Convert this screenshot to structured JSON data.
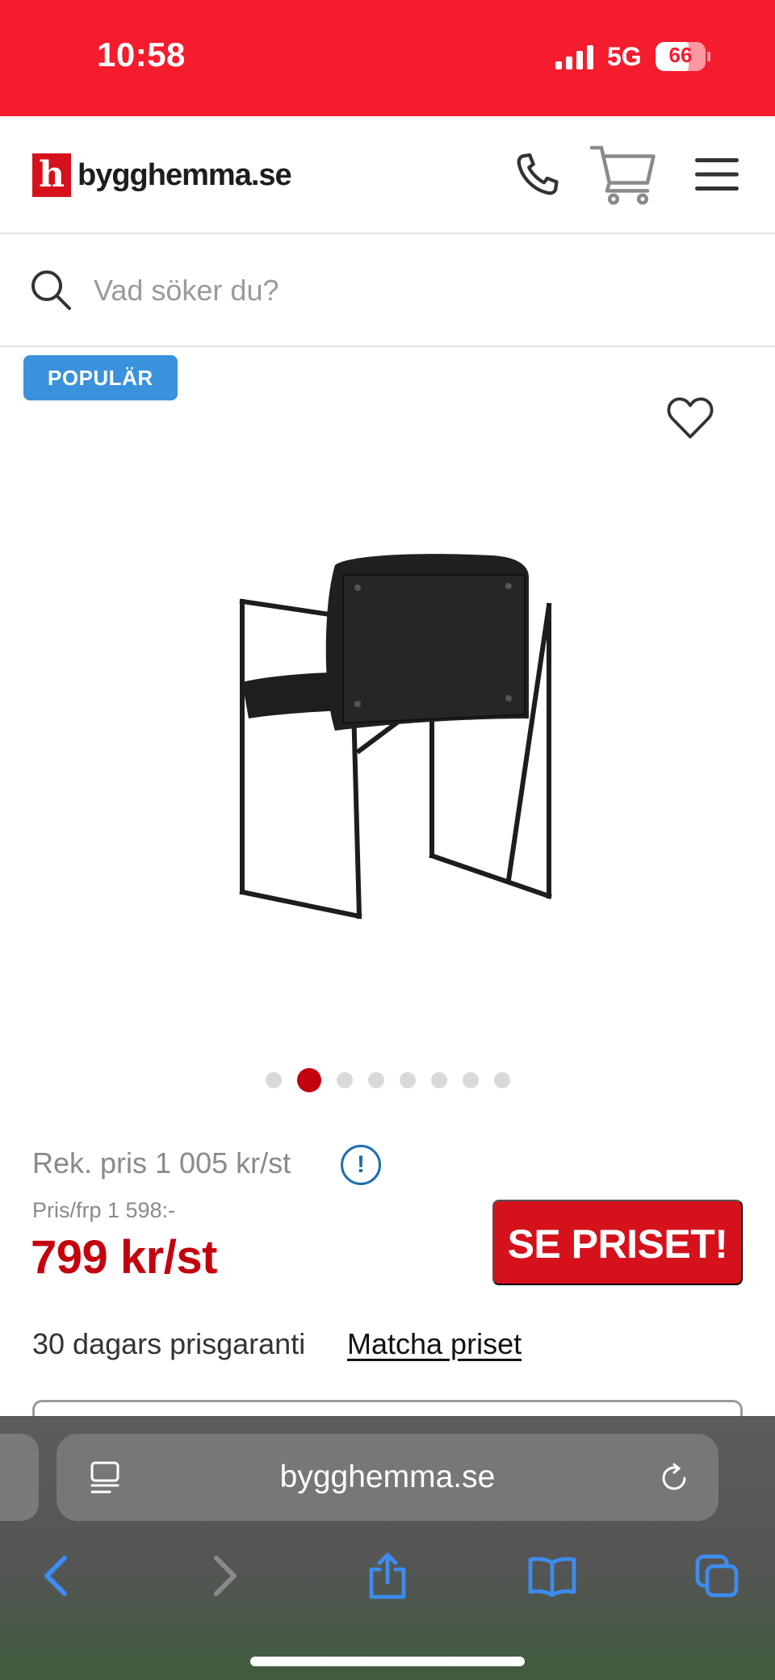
{
  "status_bar": {
    "time": "10:58",
    "network": "5G",
    "battery": "66",
    "background_color": "#f51c2e"
  },
  "header": {
    "logo_mark": "h",
    "logo_text": "bygghemma.se",
    "icons": [
      "phone-icon",
      "cart-icon",
      "menu-icon"
    ]
  },
  "search": {
    "placeholder": "Vad söker du?"
  },
  "product": {
    "badge": "POPULÄR",
    "image_alt_icon": "chair-image",
    "carousel": {
      "total": 8,
      "active_index": 1
    },
    "rek_price": "Rek. pris 1 005 kr/st",
    "info_icon_label": "!",
    "pris_frp": "Pris/frp 1 598:-",
    "price": "799 kr/st",
    "cta_label": "SE PRISET!",
    "guarantee": "30 dagars prisgaranti",
    "match_link": "Matcha priset",
    "accent_color": "#c4020e",
    "badge_color": "#3a92dc"
  },
  "browser": {
    "url": "bygghemma.se",
    "toolbar": [
      "back-icon",
      "forward-icon",
      "share-icon",
      "bookmarks-icon",
      "tabs-icon"
    ]
  }
}
